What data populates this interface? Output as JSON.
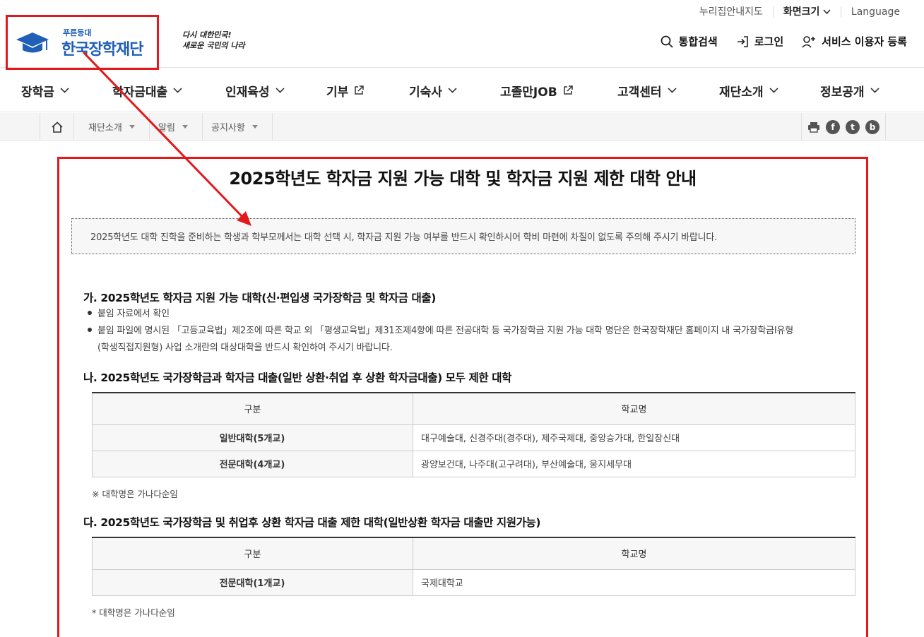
{
  "util": {
    "sitemap": "누리집안내지도",
    "font_size": "화면크기",
    "language": "Language"
  },
  "logo": {
    "small": "푸른등대",
    "main": "한국장학재단"
  },
  "slogan": {
    "line1": "다시 대한민국!",
    "line2": "새로운 국민의 나라"
  },
  "header_actions": {
    "search": "통합검색",
    "login": "로그인",
    "register": "서비스 이용자 등록"
  },
  "gnb": [
    {
      "label": "장학금"
    },
    {
      "label": "학자금대출"
    },
    {
      "label": "인재육성"
    },
    {
      "label": "기부"
    },
    {
      "label": "기숙사"
    },
    {
      "label": "고졸만JOB"
    },
    {
      "label": "고객센터"
    },
    {
      "label": "재단소개"
    },
    {
      "label": "정보공개"
    }
  ],
  "breadcrumb": [
    "재단소개",
    "알림",
    "공지사항"
  ],
  "share": {
    "fb": "f",
    "tw": "t",
    "blog": "b"
  },
  "content": {
    "title": "2025학년도 학자금 지원 가능 대학 및 학자금 지원 제한 대학 안내",
    "notice": "2025학년도 대학 진학을 준비하는 학생과 학부모께서는 대학 선택 시, 학자금 지원 가능 여부를 반드시 확인하시어 학비 마련에 차질이 없도록 주의해 주시기 바랍니다.",
    "sec_a": {
      "title": "가. 2025학년도 학자금 지원 가능 대학(신·편입생 국가장학금 및 학자금 대출)",
      "b1": "붙임 자료에서 확인",
      "b2_line1": "붙임 파일에 명시된 「고등교육법」제2조에 따른 학교 외 「평생교육법」제31조제4항에 따른 전공대학 등 국가장학금 지원 가능 대학 명단은 한국장학재단 홈페이지 내 국가장학금Ⅰ유형",
      "b2_line2": "(학생직접지원형) 사업 소개란의 대상대학을 반드시 확인하여 주시기 바랍니다."
    },
    "sec_b": {
      "title": "나. 2025학년도 국가장학금과 학자금 대출(일반 상환·취업 후 상환 학자금대출) 모두 제한 대학",
      "headers": [
        "구분",
        "학교명"
      ],
      "rows": [
        {
          "k": "일반대학(5개교)",
          "v": "대구예술대, 신경주대(경주대), 제주국제대, 중앙승가대, 한일장신대"
        },
        {
          "k": "전문대학(4개교)",
          "v": "광양보건대, 나주대(고구려대), 부산예술대, 웅지세무대"
        }
      ],
      "note": "※ 대학명은 가나다순임"
    },
    "sec_c": {
      "title": "다. 2025학년도 국가장학금 및 취업후 상환 학자금 대출 제한 대학(일반상환 학자금 대출만 지원가능)",
      "headers": [
        "구분",
        "학교명"
      ],
      "rows": [
        {
          "k": "전문대학(1개교)",
          "v": "국제대학교"
        }
      ],
      "note": "* 대학명은 가나다순임"
    }
  },
  "colors": {
    "highlight": "#e3191b",
    "brand": "#1f5fb8"
  }
}
